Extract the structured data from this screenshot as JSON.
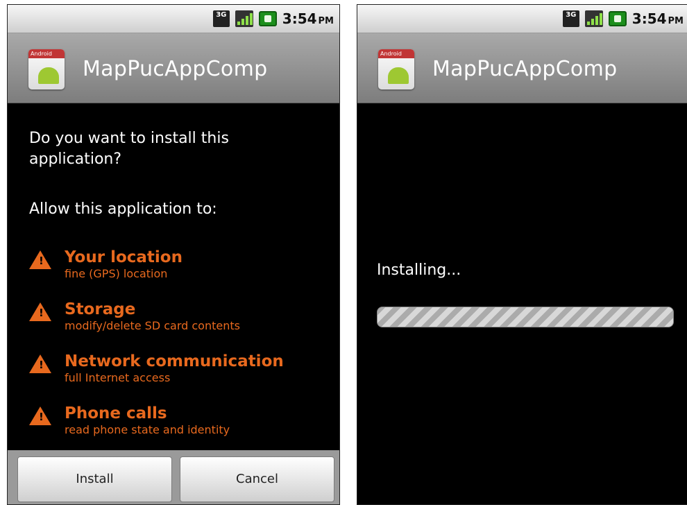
{
  "status_bar": {
    "network": "3G",
    "time": "3:54",
    "ampm": "PM"
  },
  "app": {
    "icon_ribbon": "Android",
    "name": "MapPucAppComp"
  },
  "install_screen": {
    "question": "Do you want to install this application?",
    "allow_heading": "Allow this application to:",
    "permissions": [
      {
        "title": "Your location",
        "desc": "fine (GPS) location"
      },
      {
        "title": "Storage",
        "desc": "modify/delete SD card contents"
      },
      {
        "title": "Network communication",
        "desc": "full Internet access"
      },
      {
        "title": "Phone calls",
        "desc": "read phone state and identity"
      }
    ],
    "buttons": {
      "install": "Install",
      "cancel": "Cancel"
    }
  },
  "installing_screen": {
    "status": "Installing...",
    "progress_indeterminate": true
  },
  "colors": {
    "warning": "#e8691e",
    "title_bar": "#8e8e8e",
    "background": "#000000"
  },
  "icons": [
    "3g-icon",
    "signal-icon",
    "battery-icon",
    "warning-icon",
    "android-app-icon"
  ]
}
